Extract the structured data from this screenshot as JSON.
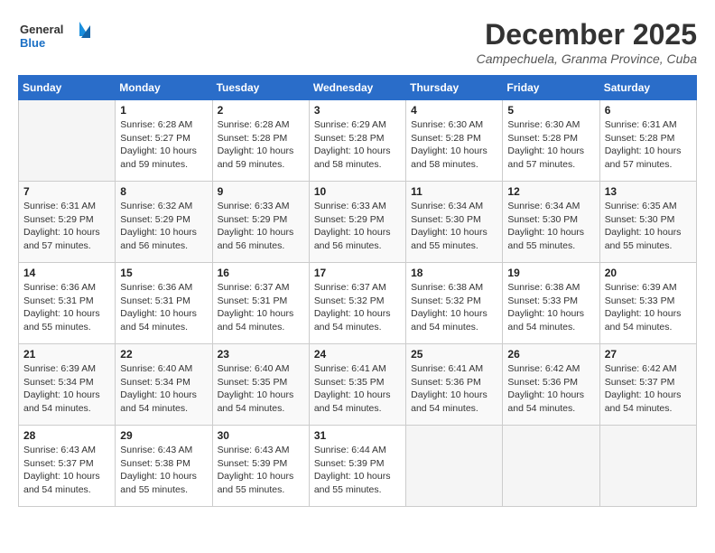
{
  "header": {
    "logo_line1": "General",
    "logo_line2": "Blue",
    "month": "December 2025",
    "location": "Campechuela, Granma Province, Cuba"
  },
  "columns": [
    "Sunday",
    "Monday",
    "Tuesday",
    "Wednesday",
    "Thursday",
    "Friday",
    "Saturday"
  ],
  "weeks": [
    [
      {
        "day": "",
        "info": ""
      },
      {
        "day": "1",
        "info": "Sunrise: 6:28 AM\nSunset: 5:27 PM\nDaylight: 10 hours\nand 59 minutes."
      },
      {
        "day": "2",
        "info": "Sunrise: 6:28 AM\nSunset: 5:28 PM\nDaylight: 10 hours\nand 59 minutes."
      },
      {
        "day": "3",
        "info": "Sunrise: 6:29 AM\nSunset: 5:28 PM\nDaylight: 10 hours\nand 58 minutes."
      },
      {
        "day": "4",
        "info": "Sunrise: 6:30 AM\nSunset: 5:28 PM\nDaylight: 10 hours\nand 58 minutes."
      },
      {
        "day": "5",
        "info": "Sunrise: 6:30 AM\nSunset: 5:28 PM\nDaylight: 10 hours\nand 57 minutes."
      },
      {
        "day": "6",
        "info": "Sunrise: 6:31 AM\nSunset: 5:28 PM\nDaylight: 10 hours\nand 57 minutes."
      }
    ],
    [
      {
        "day": "7",
        "info": "Sunrise: 6:31 AM\nSunset: 5:29 PM\nDaylight: 10 hours\nand 57 minutes."
      },
      {
        "day": "8",
        "info": "Sunrise: 6:32 AM\nSunset: 5:29 PM\nDaylight: 10 hours\nand 56 minutes."
      },
      {
        "day": "9",
        "info": "Sunrise: 6:33 AM\nSunset: 5:29 PM\nDaylight: 10 hours\nand 56 minutes."
      },
      {
        "day": "10",
        "info": "Sunrise: 6:33 AM\nSunset: 5:29 PM\nDaylight: 10 hours\nand 56 minutes."
      },
      {
        "day": "11",
        "info": "Sunrise: 6:34 AM\nSunset: 5:30 PM\nDaylight: 10 hours\nand 55 minutes."
      },
      {
        "day": "12",
        "info": "Sunrise: 6:34 AM\nSunset: 5:30 PM\nDaylight: 10 hours\nand 55 minutes."
      },
      {
        "day": "13",
        "info": "Sunrise: 6:35 AM\nSunset: 5:30 PM\nDaylight: 10 hours\nand 55 minutes."
      }
    ],
    [
      {
        "day": "14",
        "info": "Sunrise: 6:36 AM\nSunset: 5:31 PM\nDaylight: 10 hours\nand 55 minutes."
      },
      {
        "day": "15",
        "info": "Sunrise: 6:36 AM\nSunset: 5:31 PM\nDaylight: 10 hours\nand 54 minutes."
      },
      {
        "day": "16",
        "info": "Sunrise: 6:37 AM\nSunset: 5:31 PM\nDaylight: 10 hours\nand 54 minutes."
      },
      {
        "day": "17",
        "info": "Sunrise: 6:37 AM\nSunset: 5:32 PM\nDaylight: 10 hours\nand 54 minutes."
      },
      {
        "day": "18",
        "info": "Sunrise: 6:38 AM\nSunset: 5:32 PM\nDaylight: 10 hours\nand 54 minutes."
      },
      {
        "day": "19",
        "info": "Sunrise: 6:38 AM\nSunset: 5:33 PM\nDaylight: 10 hours\nand 54 minutes."
      },
      {
        "day": "20",
        "info": "Sunrise: 6:39 AM\nSunset: 5:33 PM\nDaylight: 10 hours\nand 54 minutes."
      }
    ],
    [
      {
        "day": "21",
        "info": "Sunrise: 6:39 AM\nSunset: 5:34 PM\nDaylight: 10 hours\nand 54 minutes."
      },
      {
        "day": "22",
        "info": "Sunrise: 6:40 AM\nSunset: 5:34 PM\nDaylight: 10 hours\nand 54 minutes."
      },
      {
        "day": "23",
        "info": "Sunrise: 6:40 AM\nSunset: 5:35 PM\nDaylight: 10 hours\nand 54 minutes."
      },
      {
        "day": "24",
        "info": "Sunrise: 6:41 AM\nSunset: 5:35 PM\nDaylight: 10 hours\nand 54 minutes."
      },
      {
        "day": "25",
        "info": "Sunrise: 6:41 AM\nSunset: 5:36 PM\nDaylight: 10 hours\nand 54 minutes."
      },
      {
        "day": "26",
        "info": "Sunrise: 6:42 AM\nSunset: 5:36 PM\nDaylight: 10 hours\nand 54 minutes."
      },
      {
        "day": "27",
        "info": "Sunrise: 6:42 AM\nSunset: 5:37 PM\nDaylight: 10 hours\nand 54 minutes."
      }
    ],
    [
      {
        "day": "28",
        "info": "Sunrise: 6:43 AM\nSunset: 5:37 PM\nDaylight: 10 hours\nand 54 minutes."
      },
      {
        "day": "29",
        "info": "Sunrise: 6:43 AM\nSunset: 5:38 PM\nDaylight: 10 hours\nand 55 minutes."
      },
      {
        "day": "30",
        "info": "Sunrise: 6:43 AM\nSunset: 5:39 PM\nDaylight: 10 hours\nand 55 minutes."
      },
      {
        "day": "31",
        "info": "Sunrise: 6:44 AM\nSunset: 5:39 PM\nDaylight: 10 hours\nand 55 minutes."
      },
      {
        "day": "",
        "info": ""
      },
      {
        "day": "",
        "info": ""
      },
      {
        "day": "",
        "info": ""
      }
    ]
  ]
}
